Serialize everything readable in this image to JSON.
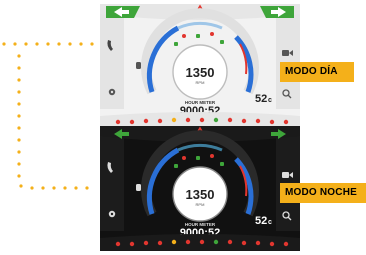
{
  "labels": {
    "day_mode": "MODO DÍA",
    "night_mode": "MODO NOCHE"
  },
  "dashboard": {
    "rpm_value": "1350",
    "rpm_unit": "RPM",
    "hour_meter_label": "HOUR METER",
    "hour_meter_value": "9000:52",
    "temperature": "52",
    "temperature_unit": "c"
  },
  "colors": {
    "accent_orange": "#f4b01a",
    "arrow_green": "#3ea53a",
    "warning_red": "#e2362f",
    "gauge_blue": "#2a6fd6",
    "night_bg": "#111111",
    "day_bg": "#f2f2f2"
  },
  "icons": {
    "left": [
      "phone-icon",
      "hand-icon",
      "gear-icon"
    ],
    "right": [
      "camera-icon",
      "zoom-icon"
    ],
    "top": [
      "left-turn-arrow-icon",
      "hazard-triangle-icon",
      "right-turn-arrow-icon"
    ]
  }
}
